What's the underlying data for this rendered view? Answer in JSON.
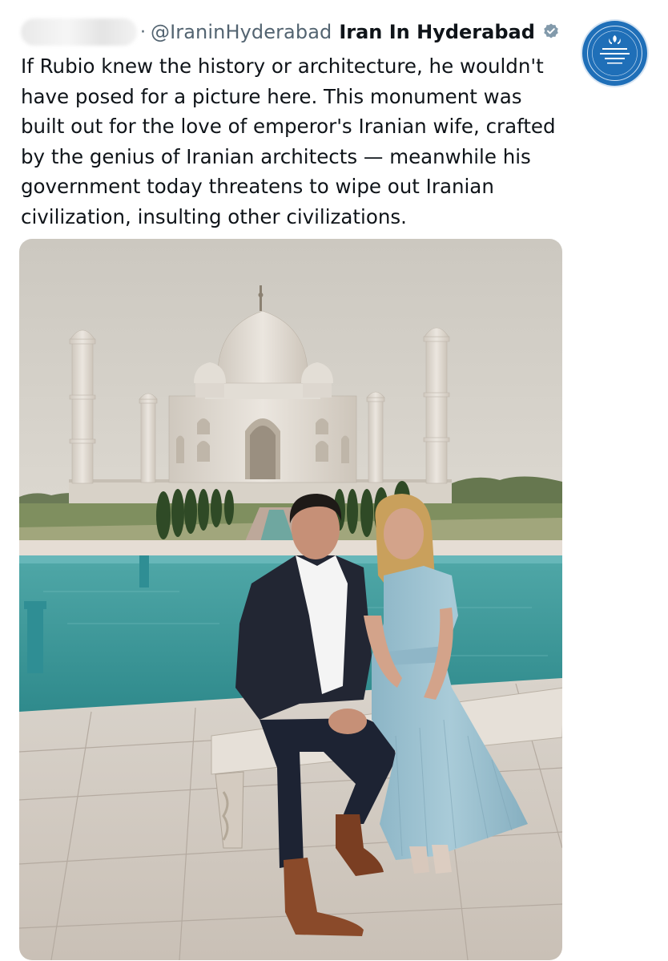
{
  "tweet": {
    "handle": "@IraninHyderabad",
    "separator": "·",
    "display_name": "Iran In Hyderabad",
    "text": "If Rubio knew the history or architecture, he wouldn't\nhave posed for a picture here. This monument was\nbuilt out for the love of emperor's Iranian wife, crafted\nby the genius of Iranian architects — meanwhile his\ngovernment today  threatens to wipe out Iranian\ncivilization, insulting other civilizations.",
    "verified_icon": "verified-badge-icon",
    "avatar_icon": "emblem-logo-icon"
  },
  "colors": {
    "handle": "#536471",
    "text": "#0f1419",
    "avatar": "#1f6fb8"
  }
}
